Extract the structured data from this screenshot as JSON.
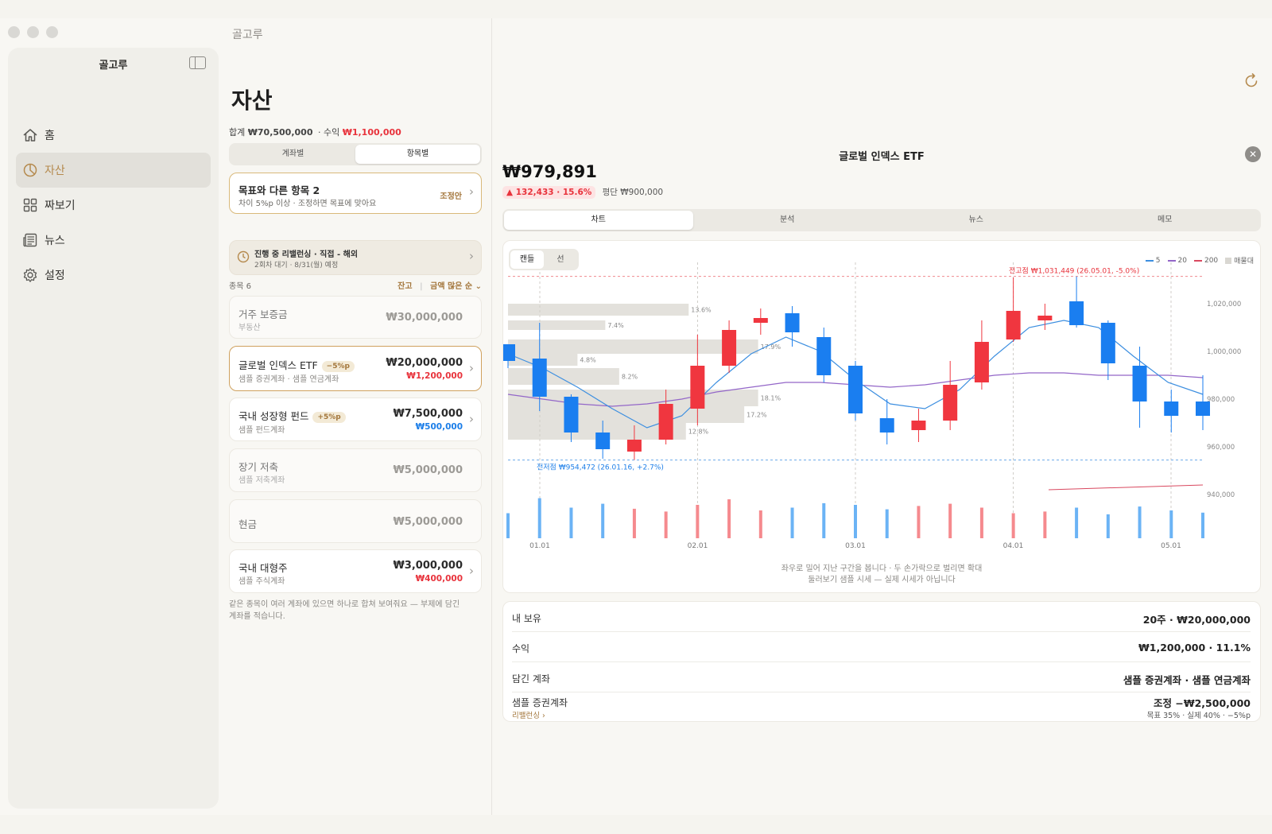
{
  "window": {
    "title": "골고루"
  },
  "sidebar": {
    "title": "골고루",
    "items": [
      {
        "label": "홈",
        "icon": "home-icon"
      },
      {
        "label": "자산",
        "icon": "pie-chart-icon",
        "active": true
      },
      {
        "label": "짜보기",
        "icon": "grid-icon"
      },
      {
        "label": "뉴스",
        "icon": "newspaper-icon"
      },
      {
        "label": "설정",
        "icon": "gear-icon"
      }
    ]
  },
  "assets": {
    "title": "자산",
    "total_label": "합계",
    "total": "₩70,500,000",
    "profit_label": "· 수익",
    "profit": "₩1,100,000",
    "segments": [
      "계좌별",
      "항목별"
    ],
    "selected_segment": "항목별",
    "alert": {
      "title": "목표와 다른 항목 2",
      "subtitle": "차이 5%p 이상 · 조정하면 목표에 맞아요",
      "action": "조정안"
    },
    "rebalance": {
      "title": "진행 중 리밸런싱 · 직접 - 해외",
      "subtitle": "2회차 대기 · 8/31(월) 예정"
    },
    "list_count": "종목 6",
    "sort_balance": "잔고",
    "sort_order": "금액 많은 순",
    "items": [
      {
        "name": "거주 보증금",
        "account": "부동산",
        "amount": "₩30,000,000",
        "change": "",
        "badge": ""
      },
      {
        "name": "글로벌 인덱스 ETF",
        "account": "샘플 증권계좌 · 샘플 연금계좌",
        "amount": "₩20,000,000",
        "change": "₩1,200,000",
        "badge": "−5%p"
      },
      {
        "name": "국내 성장형 펀드",
        "account": "샘플 펀드계좌",
        "amount": "₩7,500,000",
        "change": "₩500,000",
        "badge": "+5%p"
      },
      {
        "name": "장기 저축",
        "account": "샘플 저축계좌",
        "amount": "₩5,000,000",
        "change": "",
        "badge": ""
      },
      {
        "name": "현금",
        "account": "",
        "amount": "₩5,000,000",
        "change": "",
        "badge": ""
      },
      {
        "name": "국내 대형주",
        "account": "샘플 주식계좌",
        "amount": "₩3,000,000",
        "change": "₩400,000",
        "badge": ""
      }
    ],
    "footnote": "같은 종목이 여러 계좌에 있으면 하나로 합쳐 보여줘요 — 부제에 담긴 계좌를 적습니다."
  },
  "detail": {
    "title": "글로벌 인덱스 ETF",
    "price": "₩979,891",
    "change": "▲ 132,433 · 15.6%",
    "avg": "평단 ₩900,000",
    "tabs": [
      "차트",
      "분석",
      "뉴스",
      "메모"
    ],
    "selected_tab": "차트",
    "chart_types": [
      "캔들",
      "선"
    ],
    "selected_chart_type": "캔들",
    "hint1": "좌우로 밀어 지난 구간을 봅니다 · 두 손가락으로 벌리면 확대",
    "hint2": "둘러보기 샘플 시세 — 실제 시세가 아닙니다",
    "info": [
      {
        "label": "내 보유",
        "value": "20주 · ₩20,000,000"
      },
      {
        "label": "수익",
        "value": "₩1,200,000 · 11.1%"
      },
      {
        "label": "담긴 계좌",
        "value": "샘플 증권계좌 · 샘플 연금계좌"
      },
      {
        "label": "샘플 증권계좌",
        "value": "조정 −₩2,500,000",
        "sub": "목표 35% · 실제 40% · −5%p",
        "link": "리밸런싱 ›"
      }
    ]
  },
  "chart_data": {
    "type": "candlestick",
    "legend": [
      "5",
      "20",
      "200",
      "매물대"
    ],
    "colors": {
      "up": "#f0363f",
      "down": "#1a7ef0",
      "ma5": "#3d8fe0",
      "ma20": "#9366c8",
      "ma200": "#d9485f",
      "volume_profile": "#e3e1dc"
    },
    "yticks": [
      1020000,
      1000000,
      980000,
      960000,
      940000
    ],
    "ylim": [
      935000,
      1034000
    ],
    "xticks": [
      "01.01",
      "02.01",
      "03.01",
      "04.01",
      "05.01"
    ],
    "high_label": "전고점 ₩1,031,449 (26.05.01, -5.0%)",
    "high_value": 1031449,
    "low_label": "전저점 ₩954,472 (26.01.16, +2.7%)",
    "low_value": 954472,
    "candles": [
      [
        1003000,
        996000,
        1003000,
        993000
      ],
      [
        997000,
        981000,
        1012000,
        975000
      ],
      [
        981000,
        966000,
        982000,
        962000
      ],
      [
        966000,
        959000,
        971000,
        955000
      ],
      [
        958000,
        963000,
        969000,
        954500
      ],
      [
        963000,
        978000,
        984000,
        961000
      ],
      [
        976000,
        994000,
        1007000,
        969000
      ],
      [
        994000,
        1009000,
        1013000,
        991000
      ],
      [
        1012000,
        1014000,
        1018000,
        1007000
      ],
      [
        1016000,
        1008000,
        1019000,
        1002000
      ],
      [
        1006000,
        990000,
        1010000,
        987000
      ],
      [
        994000,
        974000,
        996000,
        971000
      ],
      [
        972000,
        966000,
        980000,
        961000
      ],
      [
        967000,
        971000,
        976000,
        962000
      ],
      [
        971000,
        986000,
        996000,
        967000
      ],
      [
        987000,
        1004000,
        1013000,
        984000
      ],
      [
        1005000,
        1017000,
        1031000,
        1004000
      ],
      [
        1013000,
        1015000,
        1020000,
        1009000
      ],
      [
        1021000,
        1011000,
        1031449,
        1010000
      ],
      [
        1012000,
        995000,
        1013000,
        988000
      ],
      [
        994000,
        979000,
        1002000,
        968000
      ],
      [
        979000,
        973000,
        984000,
        966000
      ],
      [
        979000,
        973000,
        990000,
        967000
      ]
    ],
    "volumes": [
      0.45,
      0.72,
      0.55,
      0.62,
      0.53,
      0.48,
      0.6,
      0.7,
      0.5,
      0.55,
      0.63,
      0.6,
      0.52,
      0.58,
      0.62,
      0.55,
      0.45,
      0.48,
      0.55,
      0.43,
      0.57,
      0.5,
      0.46
    ],
    "ma5": [
      999000,
      993000,
      985000,
      976000,
      968000,
      973000,
      987000,
      999000,
      1006000,
      1000000,
      988000,
      978000,
      976000,
      984000,
      998000,
      1010000,
      1013000,
      1010000,
      998000,
      987000,
      982000
    ],
    "ma20": [
      982000,
      980000,
      978000,
      977000,
      978000,
      980000,
      983000,
      985000,
      987000,
      987000,
      986000,
      985000,
      986000,
      988000,
      990000,
      991000,
      991000,
      990000,
      990000,
      990000,
      989000
    ],
    "ma200": [
      942000,
      944000
    ],
    "volume_profile": [
      {
        "label": "13.6%",
        "from": 1015000,
        "to": 1020000,
        "width": 0.13
      },
      {
        "label": "7.4%",
        "from": 1009000,
        "to": 1013000,
        "width": 0.07
      },
      {
        "label": "17.9%",
        "from": 999000,
        "to": 1005000,
        "width": 0.18
      },
      {
        "label": "4.8%",
        "from": 994000,
        "to": 999000,
        "width": 0.05
      },
      {
        "label": "8.2%",
        "from": 986000,
        "to": 993000,
        "width": 0.08
      },
      {
        "label": "18.1%",
        "from": 977000,
        "to": 984000,
        "width": 0.18
      },
      {
        "label": "17.2%",
        "from": 970000,
        "to": 977000,
        "width": 0.17
      },
      {
        "label": "12.8%",
        "from": 963000,
        "to": 970000,
        "width": 0.128
      }
    ]
  }
}
